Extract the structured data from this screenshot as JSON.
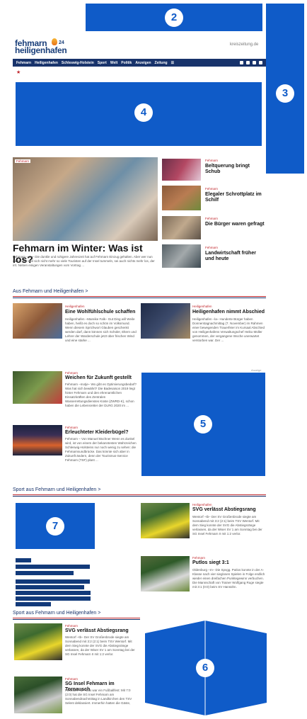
{
  "header": {
    "logo_line1": "fehmarn",
    "logo_24": "24",
    "logo_line2": "heiligenhafen",
    "kreiszeitung": "kreiszeitung.de"
  },
  "nav": {
    "items": [
      "Fehmarn",
      "Heiligenhafen",
      "Schleswig-Holstein",
      "Sport",
      "Welt",
      "Politik",
      "Anzeigen",
      "Zeitung"
    ]
  },
  "markers": [
    "2",
    "3",
    "4",
    "5",
    "6",
    "7"
  ],
  "hero": {
    "tag": "Fehmarn",
    "headline": "Fehmarn im Winter: Was ist los?",
    "teaser": "Fehmarn –ew– Die dunkle und ruhigere Jahreszeit hat auf Fehmarn Einzug gehalten. Aber wer nun meint, nur weil sich nicht mehr so viele Touristen auf der Insel tummeln, sei auch nichts mehr los, der irrt. Neben einigen Veranstaltungen vom Vortrag ..."
  },
  "side_articles": [
    {
      "tag": "Fehmarn",
      "headline": "Beltquerung bringt Schub"
    },
    {
      "tag": "Fehmarn",
      "headline": "Elegaler Schrottplatz im Schilf"
    },
    {
      "tag": "Fehmarn",
      "headline": "Die Bürger waren gefragt"
    },
    {
      "tag": "Fehmarn",
      "headline": "Landwirtschaft früher und heute"
    }
  ],
  "section1": {
    "title": "Aus Fehmarn und Heiligenhafen >",
    "articles": [
      {
        "tag": "Heiligenhafen",
        "headline": "Eine Wohlfühlschule schaffen",
        "teaser": "Heiligenhafen –Mareike Falk– Gut Ding will Weile haben, heißt es doch so schön im Volksmund. Wenn diesem Sprichwort Glauben geschenkt werden darf, dann können sich Schüler, Eltern und Lehrer der Warderschule jetzt über frischen Wind und eine starke ..."
      },
      {
        "tag": "Heiligenhafen",
        "headline": "Heiligenhafen nimmt Abschied",
        "teaser": "Heiligenhafen –la– Hunderte Bürger haben Donnerstagnachmittag (7. November) im Rahmen einer bewegenden Trauerfeier im Kursaal Abschied von Heiligenhafens Verwaltungschef Heiko Müller genommen, der vergangene Woche unerwartet verstorben war. Der ..."
      },
      {
        "tag": "Fehmarn",
        "headline": "Weichen für Zukunft gestellt",
        "teaser": "Fehmarn –motje– Wo gibt es Optimierungsbedarf? Was hat sich bewährt? Die Badesaison 2019 liegt hinter Fehmarn und den ehrenamtlichen Einsatzkräften des Zentralen Wasserrettungsdienstes Küste (ZWRD-K), schon haben die Lebensretter der DLRG 2020 im ..."
      },
      {
        "tag": "Fehmarn",
        "headline": "Erleuchteter Kleiderbügel?",
        "teaser": "Fehmarn – Von Manuel Büchner Wenn es dunkel wird, ist von einem der bekanntesten Wahrzeichen Schleswig-Holsteins nur noch wenig zu sehen: die Fehmarnsundbrücke. Das könnte sich aber in Zukunft ändern, denn der Tourismus-Service Fehmarn (TSF) plant ..."
      }
    ],
    "ad_label": "Anzeige"
  },
  "section2": {
    "title": "Sport aus Fehmarn und Heiligenhafen >",
    "articles": [
      {
        "tag": "Heiligenhafen",
        "headline": "SVG verlässt Abstiegsrang",
        "teaser": "Wentorf –tb– Der SV Großenbrode siegte am Sonnabend mit 3:2 (2:1) beim TSV Wentorf. Mit dem Sieg konnte der SVG die Abstiegsränge verlassen, da der Wiser SV 1 am Sonntag bei der SG Insel Fehmarn II mit 1:2 verlor."
      },
      {
        "tag": "Fehmarn",
        "headline": "Putlos siegt 3:1",
        "teaser": "Oldenburg –rn– Die Spvgg. Putlos konnte in der A-Klasse nach vier sieglosen Spielen in Folge endlich wieder einen dreifachen Punktegewinn verbuchen. Die Mannschaft von Trainer Wolfgang Ruge siegte mit 3:1 (0:0) beim SV Hansühn."
      }
    ]
  },
  "section3": {
    "title": "Sport aus Fehmarn und Heiligenhafen >",
    "articles": [
      {
        "tag": "Fehmarn",
        "headline": "SVG verlässt Abstiegsrang",
        "teaser": "Wentorf –tb– Der SV Großenbrode siegte am Sonnabend mit 3:2 (2:1) beim TSV Wentorf. Mit dem Sieg konnte der SVG die Abstiegsränge verlassen, da der Wiser SV 1 am Sonntag bei der SG Insel Fehmarn II mit 1:2 verlor."
      },
      {
        "tag": "Fehmarn",
        "headline": "SG Insel Fehmarn im Tornausch",
        "teaser": "Fehmarn –tb– Das war ein Fußballfest: Mit 7:0 (2:0) hat die SG Insel Fehmarn am Sonnabendnachmittag in Landkirchen den TSV Selent deklassiert. Immerhin hatten die Gäste,"
      }
    ]
  }
}
